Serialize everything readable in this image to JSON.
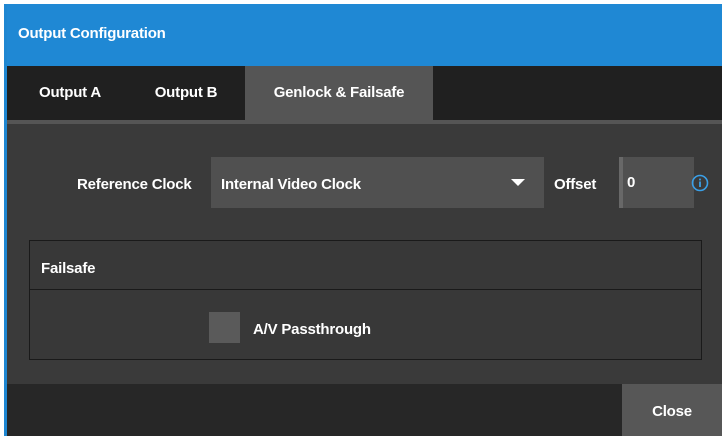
{
  "window": {
    "title": "Output Configuration"
  },
  "tabs": [
    {
      "label": "Output A",
      "active": false
    },
    {
      "label": "Output B",
      "active": false
    },
    {
      "label": "Genlock & Failsafe",
      "active": true
    }
  ],
  "genlock": {
    "reference_clock_label": "Reference Clock",
    "reference_clock_value": "Internal Video Clock",
    "offset_label": "Offset",
    "offset_value": "0",
    "info_icon": "info-icon"
  },
  "failsafe": {
    "header": "Failsafe",
    "passthrough_label": "A/V Passthrough",
    "passthrough_checked": false
  },
  "footer": {
    "close_label": "Close"
  },
  "colors": {
    "accent": "#1f88d4",
    "background": "#3a3a3a",
    "tabbar": "#202020",
    "active_tab": "#555555",
    "control": "#505050"
  }
}
